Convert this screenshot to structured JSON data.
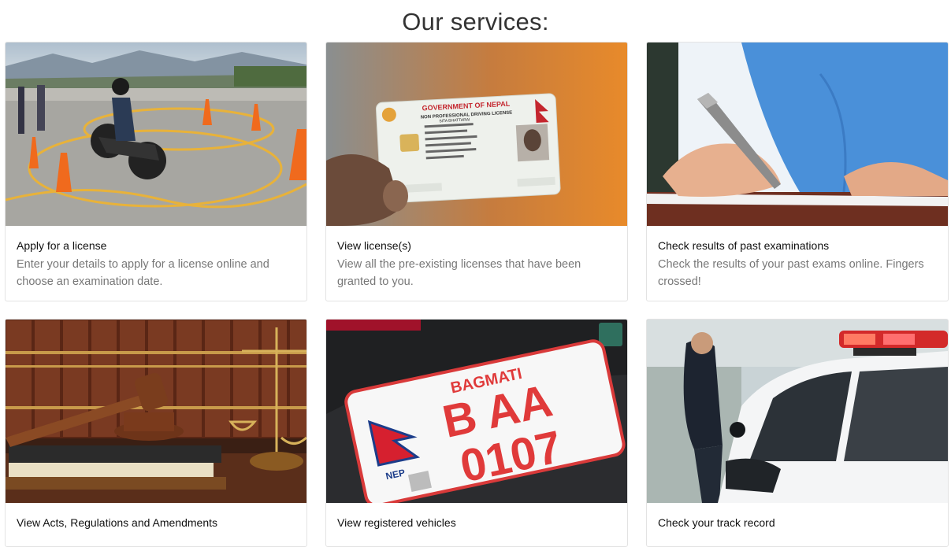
{
  "page": {
    "heading": "Our services:"
  },
  "services": [
    {
      "title": "Apply for a license",
      "description": "Enter your details to apply for a license online and choose an examination date.",
      "image": "motorcycle-driving-test-photo"
    },
    {
      "title": "View license(s)",
      "description": "View all the pre-existing licenses that have been granted to you.",
      "image": "driving-license-card-photo",
      "card": {
        "header": "GOVERNMENT OF NEPAL",
        "subheader": "NON PROFESSIONAL DRIVING LICENSE",
        "name": "SITA BHATTARAI"
      }
    },
    {
      "title": "Check results of past examinations",
      "description": "Check the results of your past exams online. Fingers crossed!",
      "image": "hand-writing-photo"
    },
    {
      "title": "View Acts, Regulations and Amendments",
      "description": "",
      "image": "gavel-law-books-photo"
    },
    {
      "title": "View registered vehicles",
      "description": "",
      "image": "license-plate-photo",
      "plate": {
        "province": "BAGMATI",
        "line1": "B AA",
        "line2": "0107",
        "country": "NEP"
      }
    },
    {
      "title": "Check your track record",
      "description": "",
      "image": "police-car-photo"
    }
  ],
  "colors": {
    "heading": "#333333",
    "title": "#111111",
    "description": "#777777",
    "border": "#e3e3e3"
  }
}
